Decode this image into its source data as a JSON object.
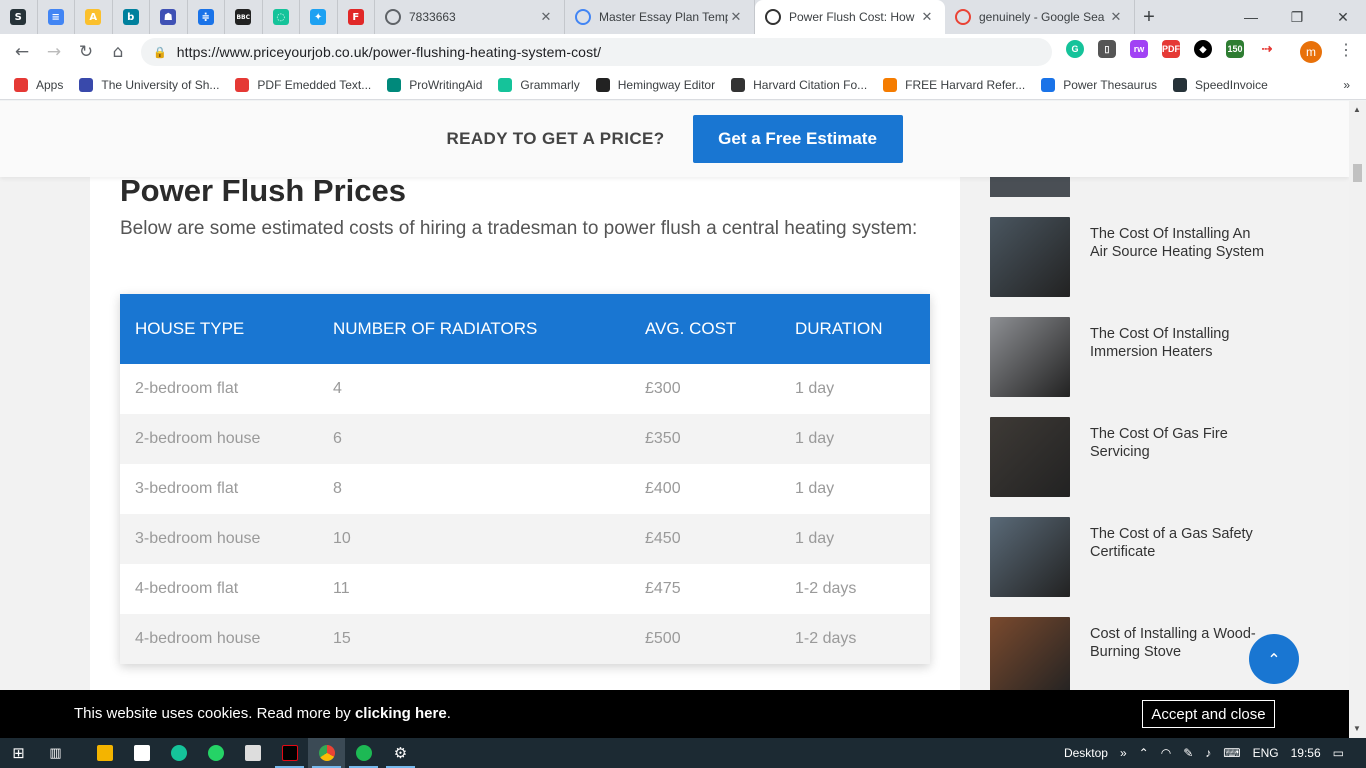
{
  "browser": {
    "pinned_tabs": [
      {
        "icon": "screencast-icon",
        "color": "#263238",
        "glyph": "S"
      },
      {
        "icon": "docs-icon",
        "color": "#4285f4",
        "glyph": "≡"
      },
      {
        "icon": "norton-icon",
        "color": "#fbc02d",
        "glyph": "A"
      },
      {
        "icon": "bing-icon",
        "color": "#00809d",
        "glyph": "b"
      },
      {
        "icon": "studyassist-icon",
        "color": "#3f51b5",
        "glyph": "☗"
      },
      {
        "icon": "translate-icon",
        "color": "#1a73e8",
        "glyph": "≑"
      },
      {
        "icon": "bbc-icon",
        "color": "#222222",
        "glyph": "BBC"
      },
      {
        "icon": "grammarly-tab-icon",
        "color": "#15c39a",
        "glyph": "◌"
      },
      {
        "icon": "twitter-icon",
        "color": "#1da1f2",
        "glyph": "✦"
      },
      {
        "icon": "flipboard-icon",
        "color": "#e12828",
        "glyph": "F"
      }
    ],
    "tabs": [
      {
        "title": "7833663",
        "icon": "globe-icon",
        "color": "#5f6368",
        "active": false,
        "width": 190
      },
      {
        "title": "Master Essay Plan Temp",
        "icon": "docs-icon",
        "color": "#4285f4",
        "active": false,
        "width": 190
      },
      {
        "title": "Power Flush Cost: How",
        "icon": "priceyourjob-icon",
        "color": "#333333",
        "active": true,
        "width": 190
      },
      {
        "title": "genuinely - Google Sea",
        "icon": "google-icon",
        "color": "#ea4335",
        "active": false,
        "width": 190
      }
    ],
    "new_tab": "+",
    "window_controls": {
      "minimize": "—",
      "restore": "❐",
      "close": "✕"
    },
    "url": "https://www.priceyourjob.co.uk/power-flushing-heating-system-cost/",
    "bookmarks": [
      {
        "label": "Apps",
        "color": "#e53935"
      },
      {
        "label": "The University of Sh...",
        "color": "#3949ab"
      },
      {
        "label": "PDF Emedded Text...",
        "color": "#e53935"
      },
      {
        "label": "ProWritingAid",
        "color": "#00897b"
      },
      {
        "label": "Grammarly",
        "color": "#15c39a"
      },
      {
        "label": "Hemingway Editor",
        "color": "#222222"
      },
      {
        "label": "Harvard Citation Fo...",
        "color": "#333333"
      },
      {
        "label": "FREE Harvard Refer...",
        "color": "#f57c00"
      },
      {
        "label": "Power Thesaurus",
        "color": "#1a73e8"
      },
      {
        "label": "SpeedInvoice",
        "color": "#263238"
      }
    ],
    "bookmarks_more": "»",
    "profile_initial": "m"
  },
  "sticky_bar": {
    "prompt": "READY TO GET A PRICE?",
    "cta": "Get a Free Estimate"
  },
  "article": {
    "heading": "Power Flush Prices",
    "intro": "Below are some estimated costs of hiring a tradesman to power flush a central heating system:",
    "table": {
      "headers": [
        "HOUSE TYPE",
        "NUMBER OF RADIATORS",
        "AVG. COST",
        "DURATION"
      ],
      "rows": [
        [
          "2-bedroom flat",
          "4",
          "£300",
          "1 day"
        ],
        [
          "2-bedroom house",
          "6",
          "£350",
          "1 day"
        ],
        [
          "3-bedroom flat",
          "8",
          "£400",
          "1 day"
        ],
        [
          "3-bedroom house",
          "10",
          "£450",
          "1 day"
        ],
        [
          "4-bedroom flat",
          "11",
          "£475",
          "1-2 days"
        ],
        [
          "4-bedroom house",
          "15",
          "£500",
          "1-2 days"
        ]
      ]
    }
  },
  "sidebar": {
    "items": [
      {
        "title": "The Cost Of Installing An Air Source Heating System",
        "thumb": "heat-pump-thumb",
        "bg": "#4a5660"
      },
      {
        "title": "The Cost Of Installing Immersion Heaters",
        "thumb": "immersion-heater-thumb",
        "bg": "#8d8f93"
      },
      {
        "title": "The Cost Of Gas Fire Servicing",
        "thumb": "gas-fire-thumb",
        "bg": "#3e3a36"
      },
      {
        "title": "The Cost of a Gas Safety Certificate",
        "thumb": "gas-safety-thumb",
        "bg": "#5a6a78"
      },
      {
        "title": "Cost of Installing a Wood-Burning Stove",
        "thumb": "wood-stove-thumb",
        "bg": "#7a4a2e"
      }
    ]
  },
  "cookie_banner": {
    "message": "This website uses cookies. Read more by ",
    "link": "clicking here",
    "suffix": ".",
    "accept": "Accept and close"
  },
  "taskbar": {
    "desktop_label": "Desktop",
    "language": "ENG",
    "time": "19:56"
  }
}
